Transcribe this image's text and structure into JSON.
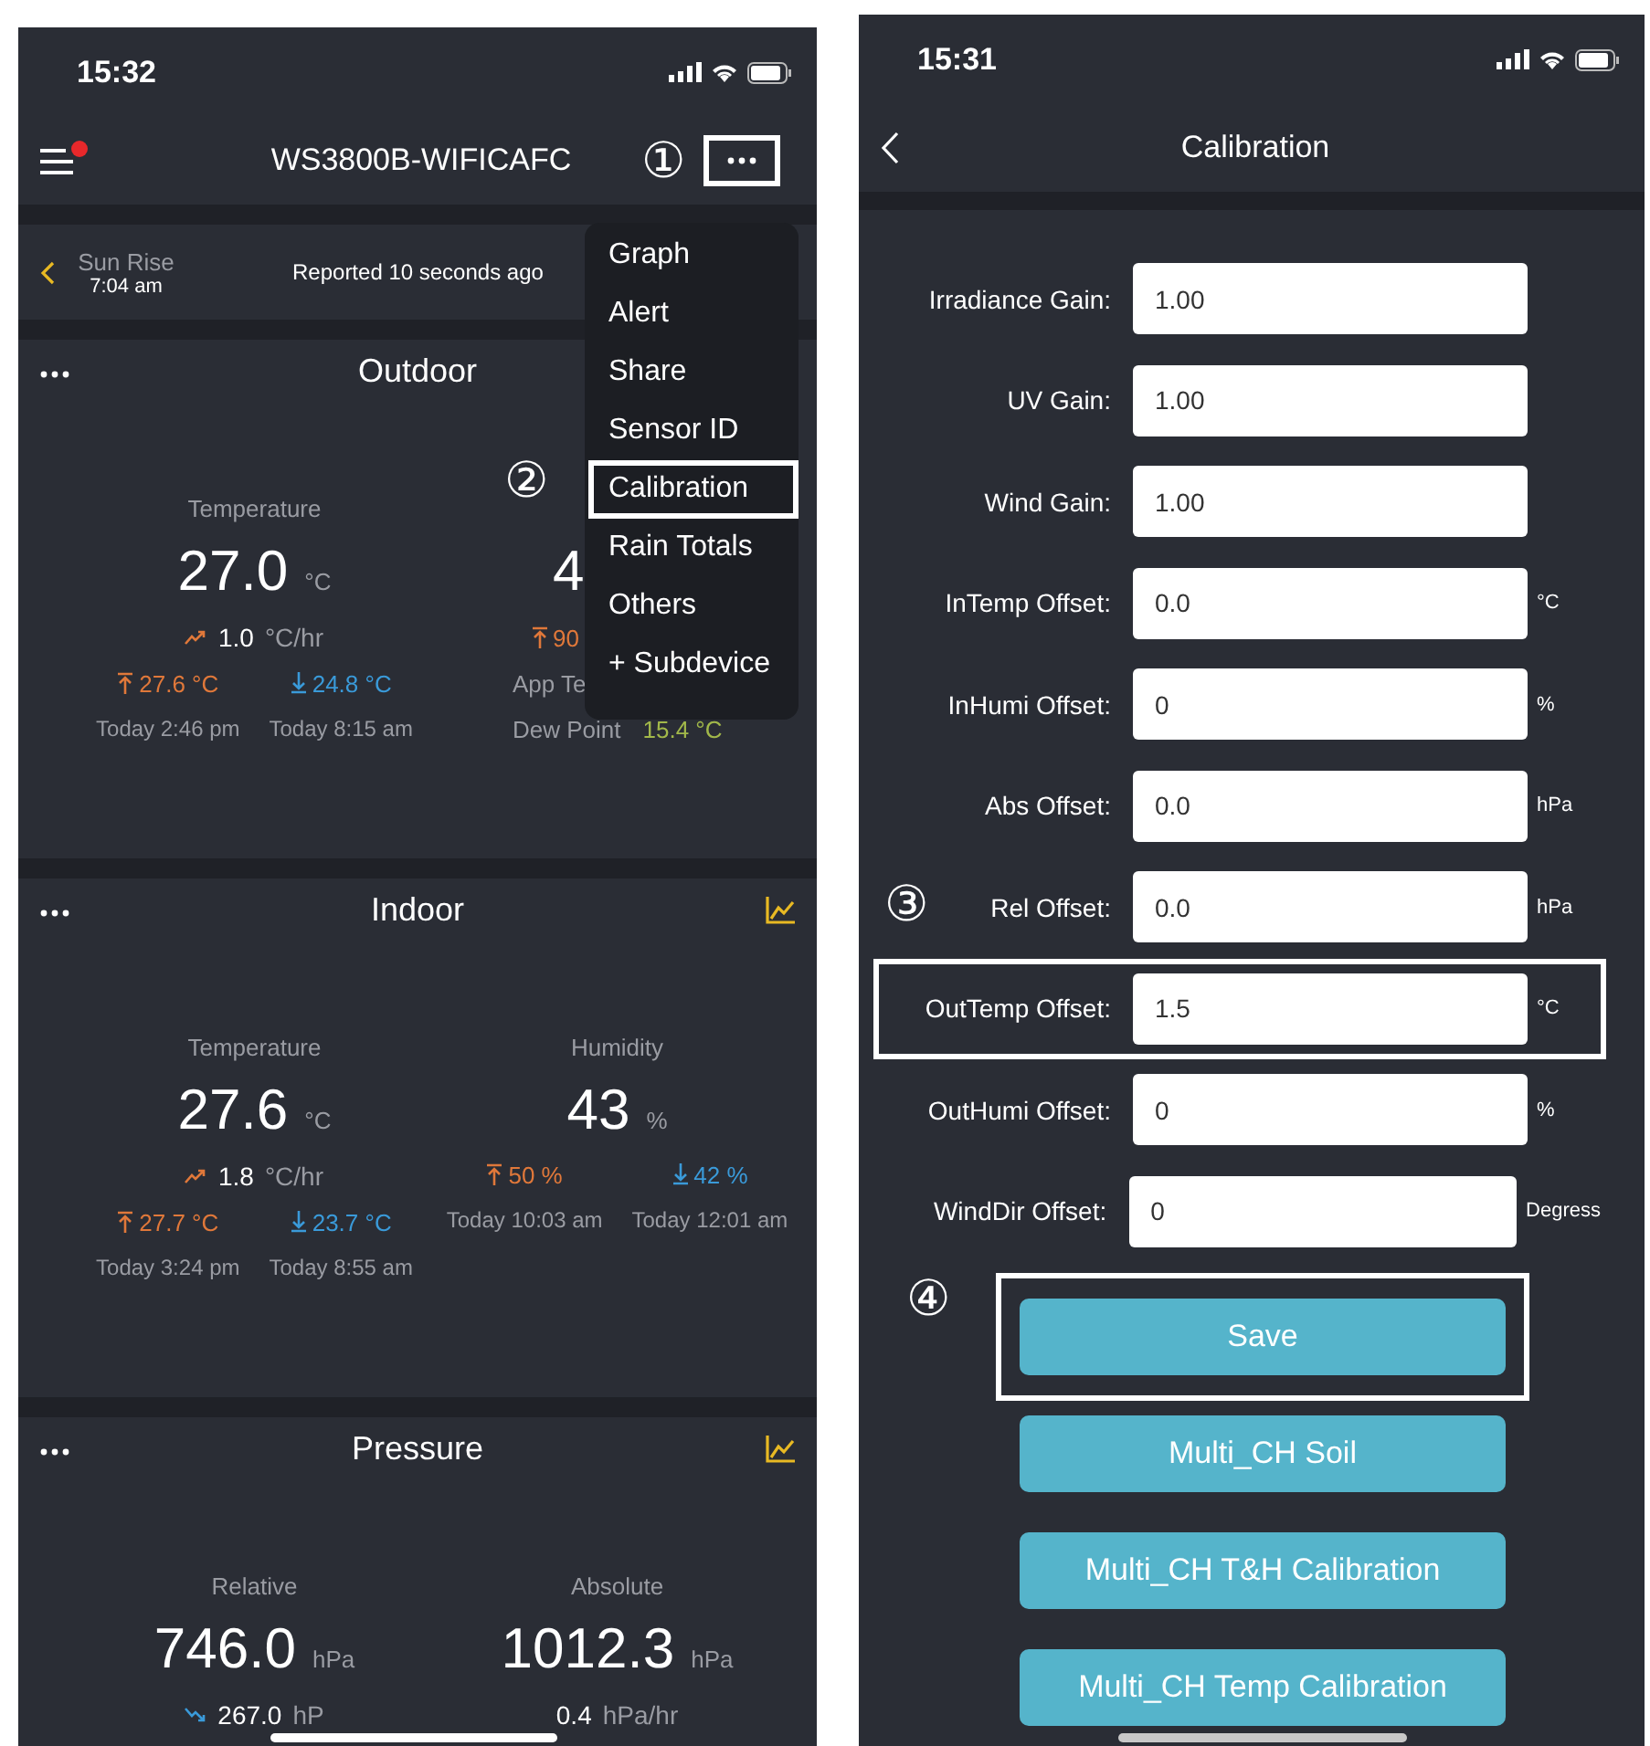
{
  "left_screen": {
    "status_bar": {
      "time": "15:32"
    },
    "header": {
      "title": "WS3800B-WIFICAFC",
      "menu_badge": true,
      "annotation": "①",
      "more_button": {
        "highlighted": true
      }
    },
    "sun_bar": {
      "label": "Sun Rise",
      "time": "7:04 am",
      "reported": "Reported 10 seconds ago"
    },
    "cards": [
      {
        "title": "Outdoor",
        "chart_icon": false,
        "columns": [
          {
            "kind": "stat",
            "label": "Temperature",
            "value": "27.0",
            "unit": "°C",
            "rate": {
              "rising": true,
              "value": "1.0",
              "unit": "°C/hr"
            },
            "high": {
              "value": "27.6 °C",
              "time": "Today 2:46 pm"
            },
            "low": {
              "value": "24.8 °C",
              "time": "Today 8:15 am"
            }
          },
          {
            "kind": "list",
            "value": "4",
            "high": {
              "value": "90"
            },
            "extras": [
              {
                "label": "App Te"
              },
              {
                "label": "Dew Point",
                "value": "15.4 °C"
              }
            ]
          }
        ]
      },
      {
        "title": "Indoor",
        "chart_icon": true,
        "columns": [
          {
            "kind": "stat",
            "label": "Temperature",
            "value": "27.6",
            "unit": "°C",
            "rate": {
              "rising": true,
              "value": "1.8",
              "unit": "°C/hr"
            },
            "high": {
              "value": "27.7 °C",
              "time": "Today 3:24 pm"
            },
            "low": {
              "value": "23.7 °C",
              "time": "Today 8:55 am"
            }
          },
          {
            "kind": "stat",
            "label": "Humidity",
            "value": "43",
            "unit": "%",
            "high": {
              "value": "50 %",
              "time": "Today 10:03 am"
            },
            "low": {
              "value": "42 %",
              "time": "Today 12:01 am"
            }
          }
        ]
      },
      {
        "title": "Pressure",
        "chart_icon": true,
        "columns": [
          {
            "kind": "stat",
            "label": "Relative",
            "value": "746.0",
            "unit": "hPa",
            "rate": {
              "rising": false,
              "value": "267.0",
              "unit": "hP"
            }
          },
          {
            "kind": "stat",
            "label": "Absolute",
            "value": "1012.3",
            "unit": "hPa",
            "rate": {
              "value": "0.4",
              "unit": "hPa/hr"
            }
          }
        ]
      }
    ],
    "menu": {
      "items": [
        {
          "label": "Graph",
          "highlighted": false
        },
        {
          "label": "Alert",
          "highlighted": false
        },
        {
          "label": "Share",
          "highlighted": false
        },
        {
          "label": "Sensor ID",
          "highlighted": false
        },
        {
          "label": "Calibration",
          "highlighted": true,
          "annotation": "②"
        },
        {
          "label": "Rain Totals",
          "highlighted": false
        },
        {
          "label": "Others",
          "highlighted": false
        },
        {
          "label": "+ Subdevice",
          "highlighted": false
        }
      ]
    }
  },
  "right_screen": {
    "status_bar": {
      "time": "15:31"
    },
    "header": {
      "title": "Calibration"
    },
    "fields": [
      {
        "label": "Irradiance Gain:",
        "value": "1.00",
        "highlighted": false
      },
      {
        "label": "UV Gain:",
        "value": "1.00",
        "highlighted": false
      },
      {
        "label": "Wind Gain:",
        "value": "1.00",
        "highlighted": false
      },
      {
        "label": "InTemp Offset:",
        "value": "0.0",
        "unit": "°C",
        "highlighted": false
      },
      {
        "label": "InHumi Offset:",
        "value": "0",
        "unit": "%",
        "highlighted": false
      },
      {
        "label": "Abs Offset:",
        "value": "0.0",
        "unit": "hPa",
        "highlighted": false
      },
      {
        "label": "Rel Offset:",
        "value": "0.0",
        "unit": "hPa",
        "highlighted": false,
        "annotation": "③"
      },
      {
        "label": "OutTemp Offset:",
        "value": "1.5",
        "unit": "°C",
        "highlighted": true
      },
      {
        "label": "OutHumi Offset:",
        "value": "0",
        "unit": "%",
        "highlighted": false
      },
      {
        "label": "WindDir Offset:",
        "value": "0",
        "unit": "Degress",
        "highlighted": false
      }
    ],
    "buttons": [
      {
        "label": "Save",
        "highlighted": true,
        "annotation": "④"
      },
      {
        "label": "Multi_CH Soil",
        "highlighted": false
      },
      {
        "label": "Multi_CH T&H Calibration",
        "highlighted": false
      },
      {
        "label": "Multi_CH Temp Calibration",
        "highlighted": false
      }
    ]
  }
}
